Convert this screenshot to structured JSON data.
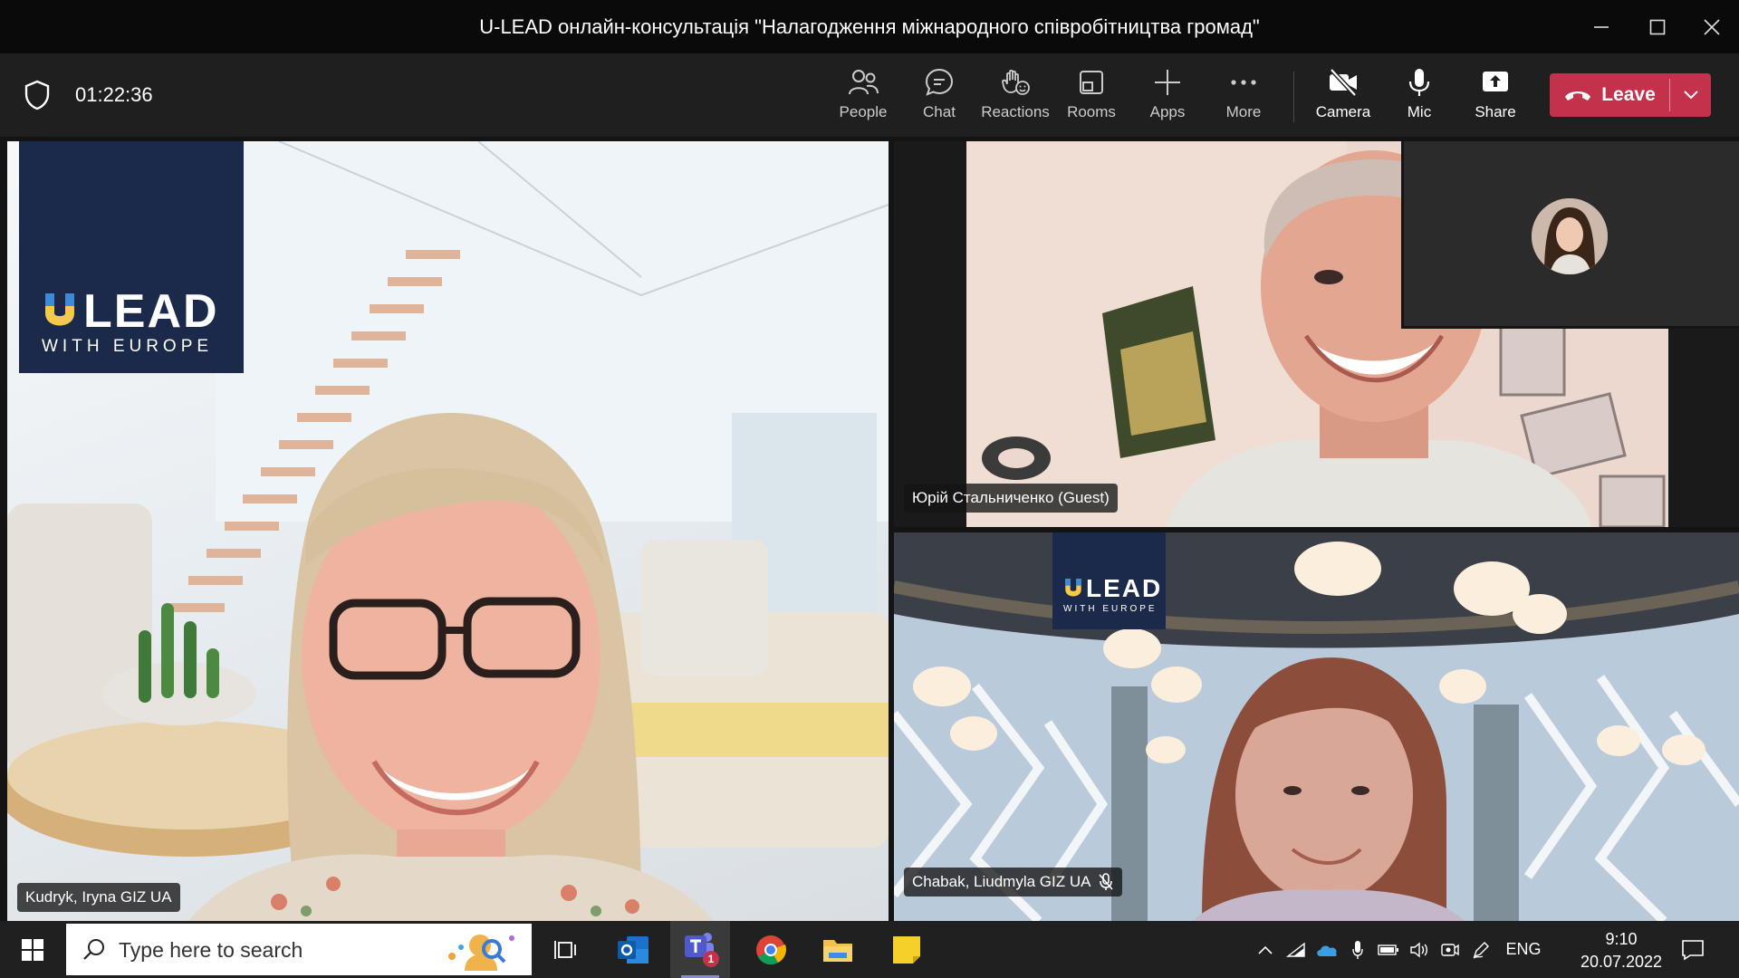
{
  "window": {
    "title": "U-LEAD онлайн-консультація \"Налагодження міжнародного співробітництва громад\""
  },
  "toolbar": {
    "timer": "01:22:36",
    "buttons": {
      "people": "People",
      "chat": "Chat",
      "reactions": "Reactions",
      "rooms": "Rooms",
      "apps": "Apps",
      "more": "More",
      "camera": "Camera",
      "mic": "Mic",
      "share": "Share"
    },
    "leave_label": "Leave",
    "leave_color": "#c4314b"
  },
  "participants": [
    {
      "name": "Kudryk, Iryna GIZ UA",
      "muted": false
    },
    {
      "name": "Юрій Стальниченко (Guest)",
      "muted": false
    },
    {
      "name": "Chabak, Liudmyla GIZ UA",
      "muted": true
    }
  ],
  "branding": {
    "logo_main": "LEAD",
    "logo_sub": "WITH EUROPE",
    "logo_bg": "#1b2a4a"
  },
  "taskbar": {
    "search_placeholder": "Type here to search",
    "language": "ENG",
    "time": "9:10",
    "date": "20.07.2022",
    "teams_badge": "1",
    "icons": [
      "start-icon",
      "task-view-icon",
      "outlook-icon",
      "teams-icon",
      "chrome-icon",
      "file-explorer-icon",
      "sticky-notes-icon"
    ]
  }
}
